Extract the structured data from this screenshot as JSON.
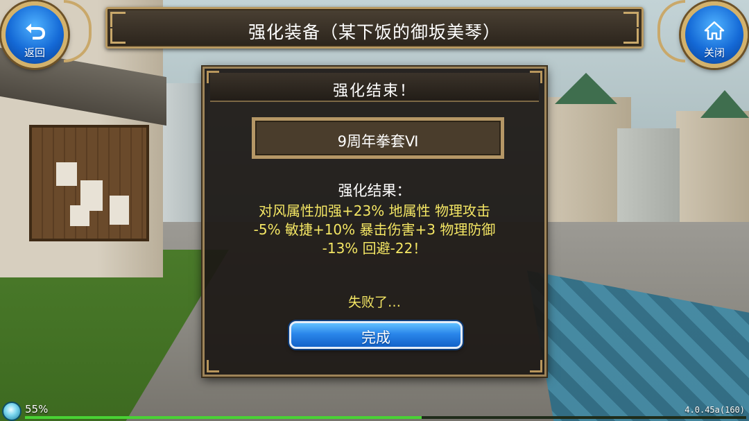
{
  "header": {
    "title": "强化装备（某下饭的御坂美琴）"
  },
  "back_button": {
    "label": "返回",
    "icon": "back-arrow-icon"
  },
  "close_button": {
    "label": "关闭",
    "icon": "home-icon"
  },
  "dialog": {
    "title": "强化结束！",
    "item_name": "9周年拳套Ⅵ",
    "result_label": "强化结果：",
    "result_lines": [
      "对风属性加强+23% 地属性 物理攻击",
      "-5% 敏捷+10% 暴击伤害+3 物理防御",
      "-13% 回避-22！"
    ],
    "fail_text": "失败了…",
    "done_label": "完成"
  },
  "status": {
    "battery_text": "55%",
    "version_text": "4.0.45a(160)",
    "progress_fraction": 0.55
  },
  "colors": {
    "result_text": "#f4e664",
    "button_blue": "#2a86ea",
    "frame_gold": "#b99a62",
    "progress_green": "#49d234"
  }
}
